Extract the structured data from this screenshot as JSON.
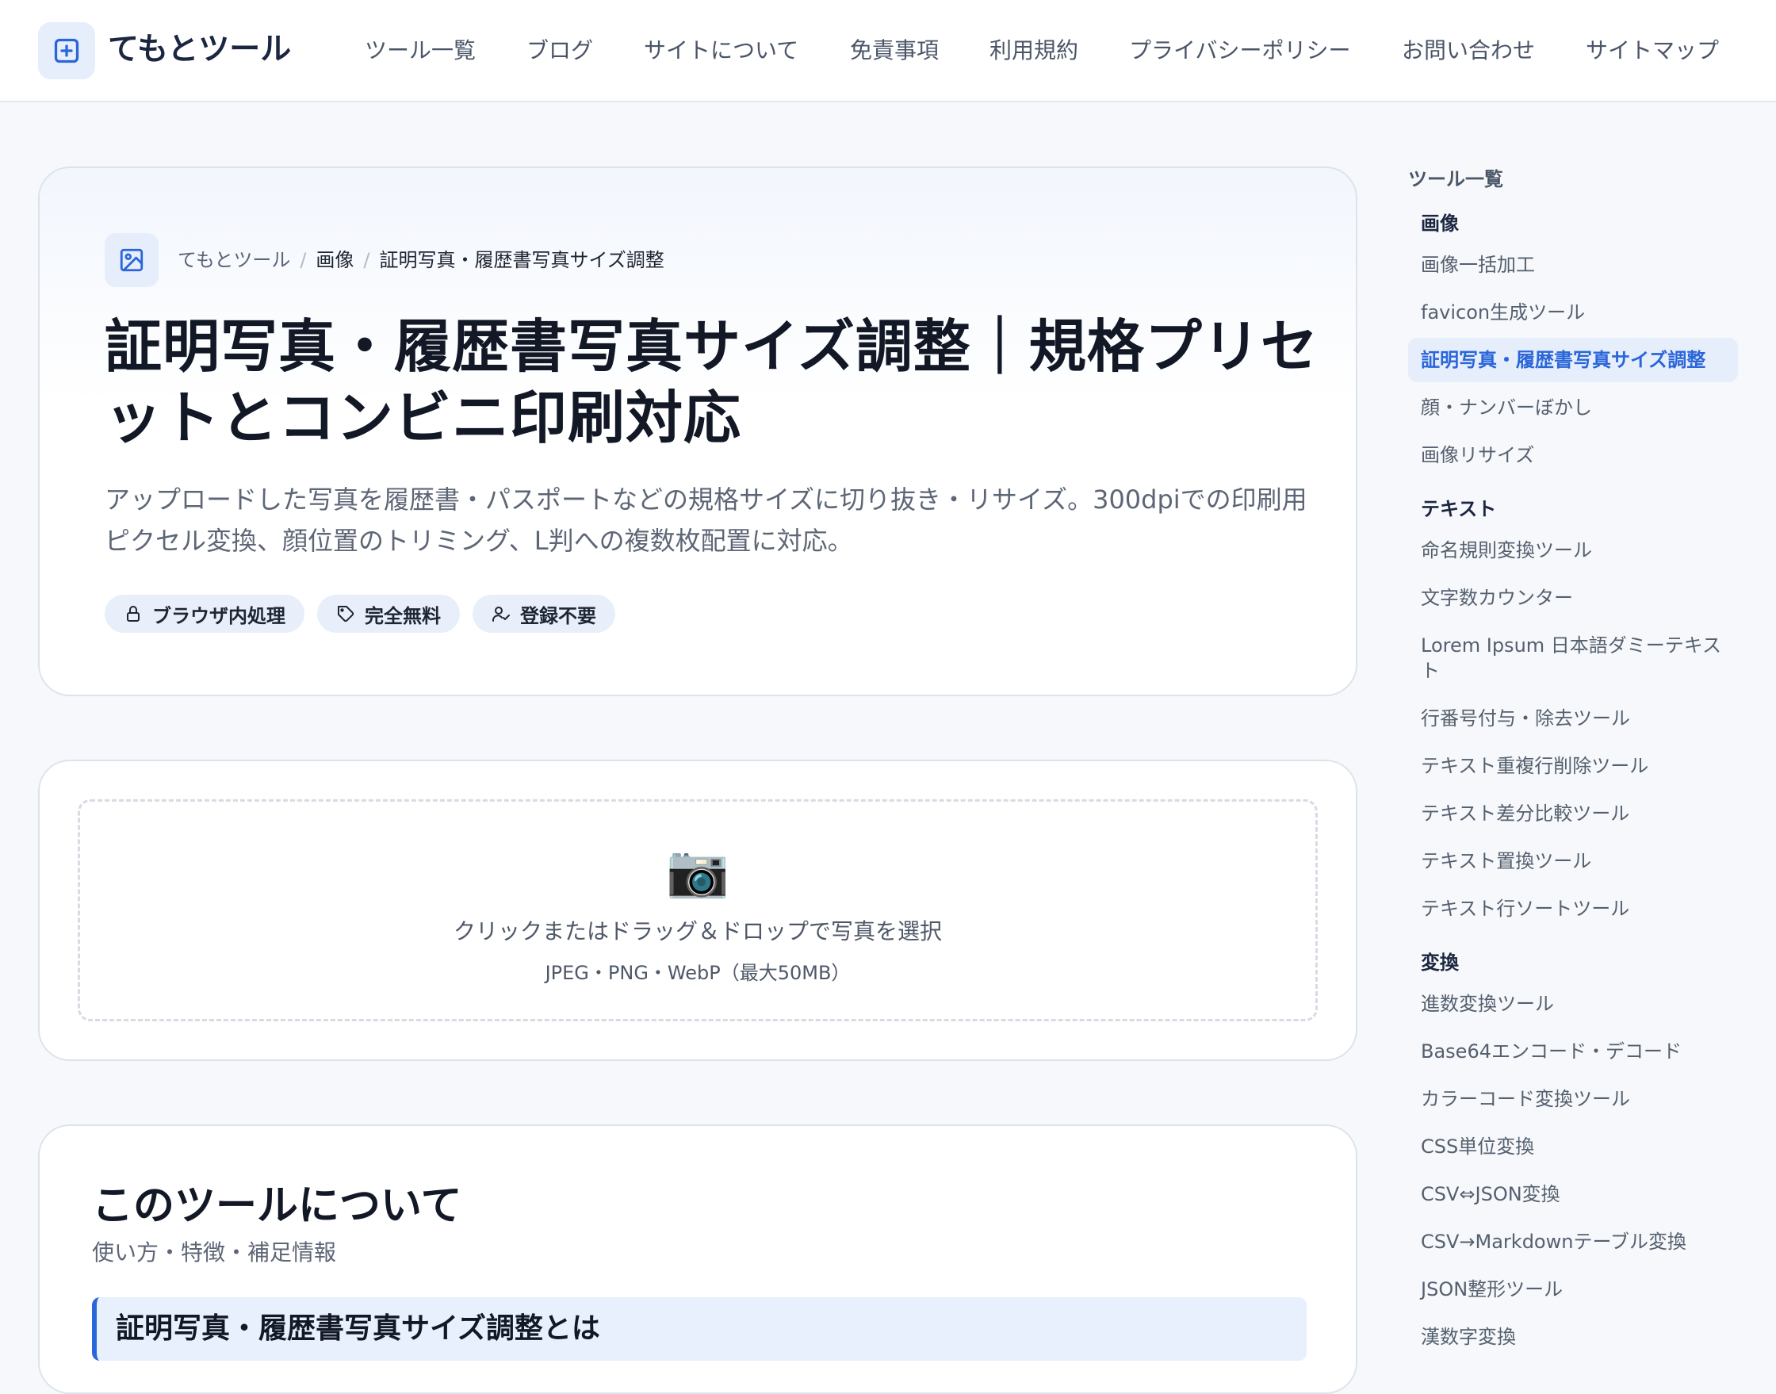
{
  "header": {
    "brand": "てもとツール",
    "nav": [
      "ツール一覧",
      "ブログ",
      "サイトについて",
      "免責事項",
      "利用規約",
      "プライバシーポリシー",
      "お問い合わせ",
      "サイトマップ"
    ]
  },
  "hero": {
    "breadcrumb": [
      "てもとツール",
      "画像",
      "証明写真・履歴書写真サイズ調整"
    ],
    "title": "証明写真・履歴書写真サイズ調整｜規格プリセットとコンビニ印刷対応",
    "description": "アップロードした写真を履歴書・パスポートなどの規格サイズに切り抜き・リサイズ。300dpiでの印刷用ピクセル変換、顔位置のトリミング、L判への複数枚配置に対応。",
    "badges": [
      {
        "label": "ブラウザ内処理",
        "icon": "lock-icon"
      },
      {
        "label": "完全無料",
        "icon": "tag-icon"
      },
      {
        "label": "登録不要",
        "icon": "user-check-icon"
      }
    ]
  },
  "upload": {
    "icon": "📷",
    "main_text": "クリックまたはドラッグ＆ドロップで写真を選択",
    "sub_text": "JPEG・PNG・WebP（最大50MB）"
  },
  "about": {
    "title": "このツールについて",
    "subtitle": "使い方・特徴・補足情報",
    "section_heading": "証明写真・履歴書写真サイズ調整とは"
  },
  "sidebar": {
    "title": "ツール一覧",
    "categories": [
      {
        "name": "画像",
        "items": [
          "画像一括加工",
          "favicon生成ツール",
          "証明写真・履歴書写真サイズ調整",
          "顔・ナンバーぼかし",
          "画像リサイズ"
        ]
      },
      {
        "name": "テキスト",
        "items": [
          "命名規則変換ツール",
          "文字数カウンター",
          "Lorem Ipsum 日本語ダミーテキスト",
          "行番号付与・除去ツール",
          "テキスト重複行削除ツール",
          "テキスト差分比較ツール",
          "テキスト置換ツール",
          "テキスト行ソートツール"
        ]
      },
      {
        "name": "変換",
        "items": [
          "進数変換ツール",
          "Base64エンコード・デコード",
          "カラーコード変換ツール",
          "CSS単位変換",
          "CSV⇔JSON変換",
          "CSV→Markdownテーブル変換",
          "JSON整形ツール",
          "漢数字変換"
        ]
      }
    ],
    "active_item": "証明写真・履歴書写真サイズ調整"
  },
  "colors": {
    "accent": "#2a66d9",
    "accent_bg": "#e6eefb",
    "page_bg": "#f6f8fb"
  }
}
